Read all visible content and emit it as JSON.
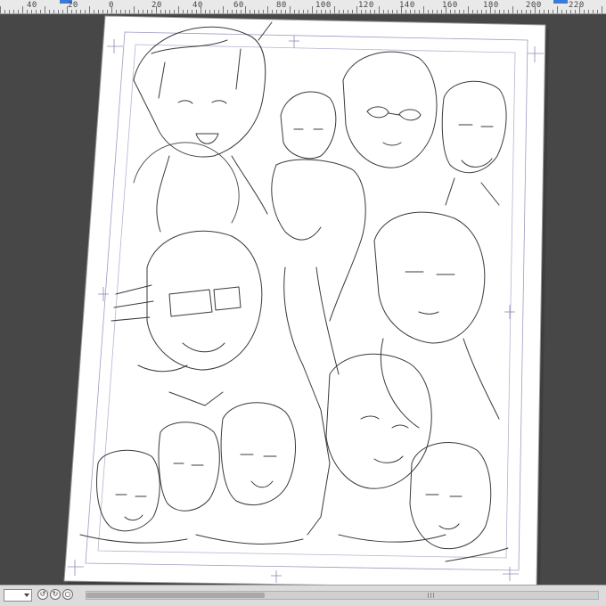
{
  "ruler": {
    "labels": [
      "40",
      "20",
      "0",
      "20",
      "40",
      "60",
      "80",
      "100",
      "120",
      "140",
      "160",
      "180",
      "200",
      "220"
    ]
  },
  "canvas": {
    "artwork": "group illustration line art"
  },
  "statusbar": {
    "zoom_value": "",
    "rotate_left_icon": "rotate-left-icon",
    "rotate_right_icon": "rotate-right-icon",
    "reset_icon": "reset-rotation-icon"
  },
  "colors": {
    "workspace": "#474747",
    "paper": "#ffffff",
    "guide": "#8f8fb8",
    "ruler_bg": "#e9e9e9"
  }
}
